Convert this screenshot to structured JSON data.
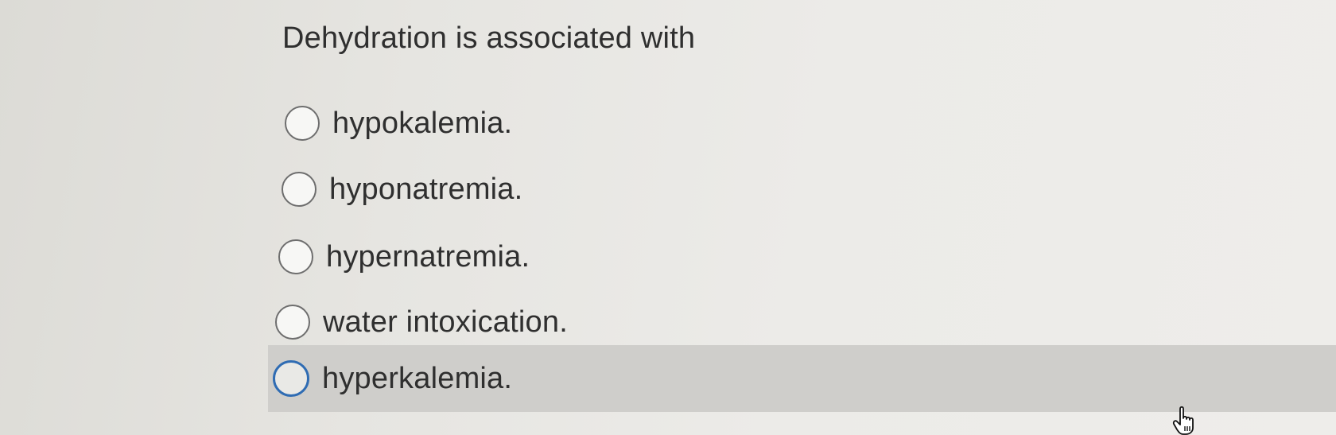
{
  "question": {
    "text": "Dehydration is associated with"
  },
  "options": [
    {
      "label": "hypokalemia.",
      "selected": false,
      "hovered": false
    },
    {
      "label": "hyponatremia.",
      "selected": false,
      "hovered": false
    },
    {
      "label": "hypernatremia.",
      "selected": false,
      "hovered": false
    },
    {
      "label": "water intoxication.",
      "selected": false,
      "hovered": false
    },
    {
      "label": "hyperkalemia.",
      "selected": false,
      "hovered": true
    }
  ],
  "colors": {
    "hover_background": "#cfcecb",
    "focus_ring": "#2f6cb3",
    "text": "#2f2f2f"
  },
  "cursor": {
    "icon": "hand-pointer-icon"
  }
}
